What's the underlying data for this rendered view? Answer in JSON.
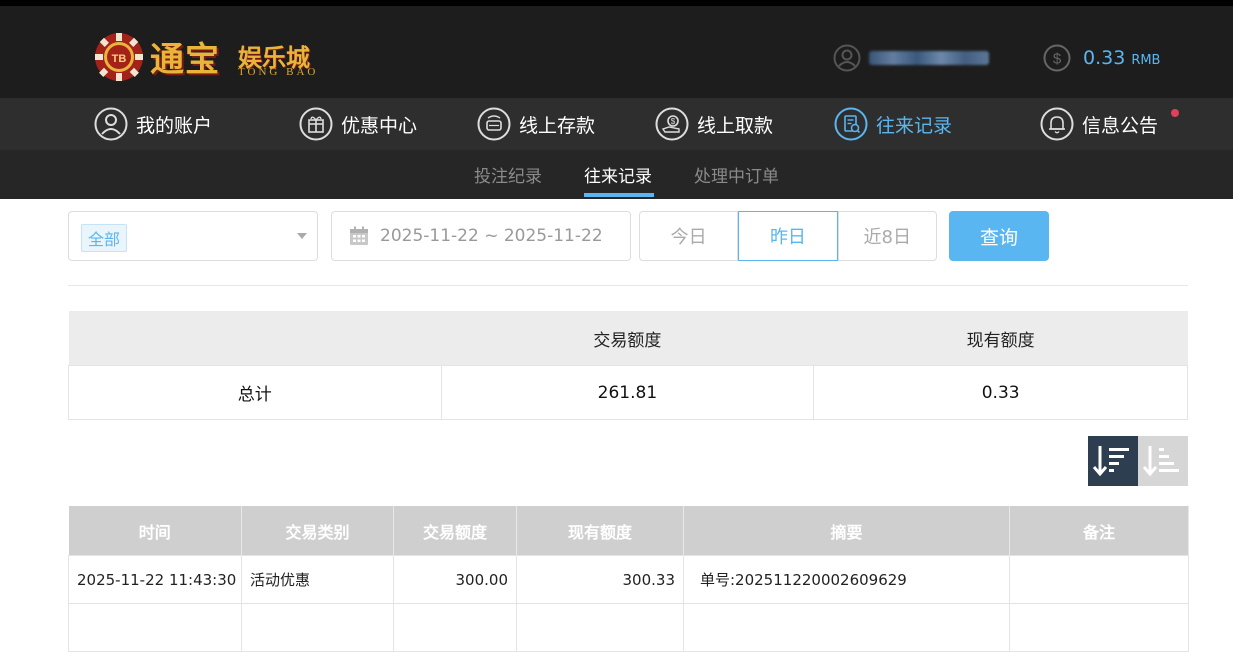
{
  "brand": {
    "chip_text": "TB",
    "name_big": "通宝",
    "name_small": "娱乐城",
    "name_en": "TONG BAO"
  },
  "account": {
    "balance": "0.33",
    "currency": "RMB"
  },
  "nav": {
    "items": [
      {
        "label": "我的账户",
        "icon": "user-icon"
      },
      {
        "label": "优惠中心",
        "icon": "gift-icon"
      },
      {
        "label": "线上存款",
        "icon": "deposit-icon"
      },
      {
        "label": "线上取款",
        "icon": "withdraw-icon"
      },
      {
        "label": "往来记录",
        "icon": "record-icon",
        "active": true
      },
      {
        "label": "信息公告",
        "icon": "bell-icon",
        "has_notification": true
      }
    ]
  },
  "subnav": {
    "items": [
      {
        "label": "投注纪录"
      },
      {
        "label": "往来记录",
        "active": true
      },
      {
        "label": "处理中订单"
      }
    ]
  },
  "filters": {
    "type_selected": "全部",
    "date_range": "2025-11-22 ~ 2025-11-22",
    "quick": [
      "今日",
      "昨日",
      "近8日"
    ],
    "quick_active": "昨日",
    "query_label": "查询"
  },
  "summary": {
    "headers": [
      "",
      "交易额度",
      "现有额度"
    ],
    "row_label": "总计",
    "transaction_total": "261.81",
    "current_balance": "0.33"
  },
  "records": {
    "headers": [
      "时间",
      "交易类别",
      "交易额度",
      "现有额度",
      "摘要",
      "备注"
    ],
    "rows": [
      {
        "time": "2025-11-22 11:43:30",
        "type": "活动优惠",
        "amount": "300.00",
        "balance": "300.33",
        "memo": "单号:202511220002609629",
        "note": ""
      },
      {
        "time": "",
        "type": "",
        "amount": "",
        "balance": "",
        "memo": "",
        "note": ""
      }
    ]
  },
  "colors": {
    "accent": "#5ab6f0",
    "header_bg": "#1d1d1d",
    "nav_bg": "#2e2e2e",
    "sort_active": "#2c3e50"
  }
}
